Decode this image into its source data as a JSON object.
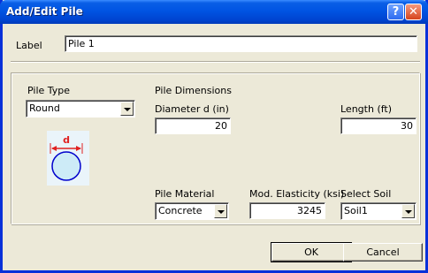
{
  "window": {
    "title": "Add/Edit Pile",
    "help_glyph": "?",
    "close_glyph": "✕"
  },
  "label_field": {
    "label": "Label",
    "value": "Pile 1"
  },
  "pile_type": {
    "label": "Pile Type",
    "selected": "Round"
  },
  "diagram": {
    "dimension_label": "d",
    "accent_color": "#e02020",
    "circle_fill": "#cdebf7",
    "circle_stroke": "#0000cc"
  },
  "pile_dimensions": {
    "heading": "Pile Dimensions",
    "diameter_label": "Diameter d (in)",
    "diameter_value": "20",
    "length_label": "Length (ft)",
    "length_value": "30"
  },
  "pile_material": {
    "label": "Pile Material",
    "selected": "Concrete"
  },
  "mod_elasticity": {
    "label": "Mod. Elasticity (ksi)",
    "value": "3245"
  },
  "select_soil": {
    "label": "Select Soil",
    "selected": "Soil1"
  },
  "buttons": {
    "ok": "OK",
    "cancel": "Cancel"
  }
}
